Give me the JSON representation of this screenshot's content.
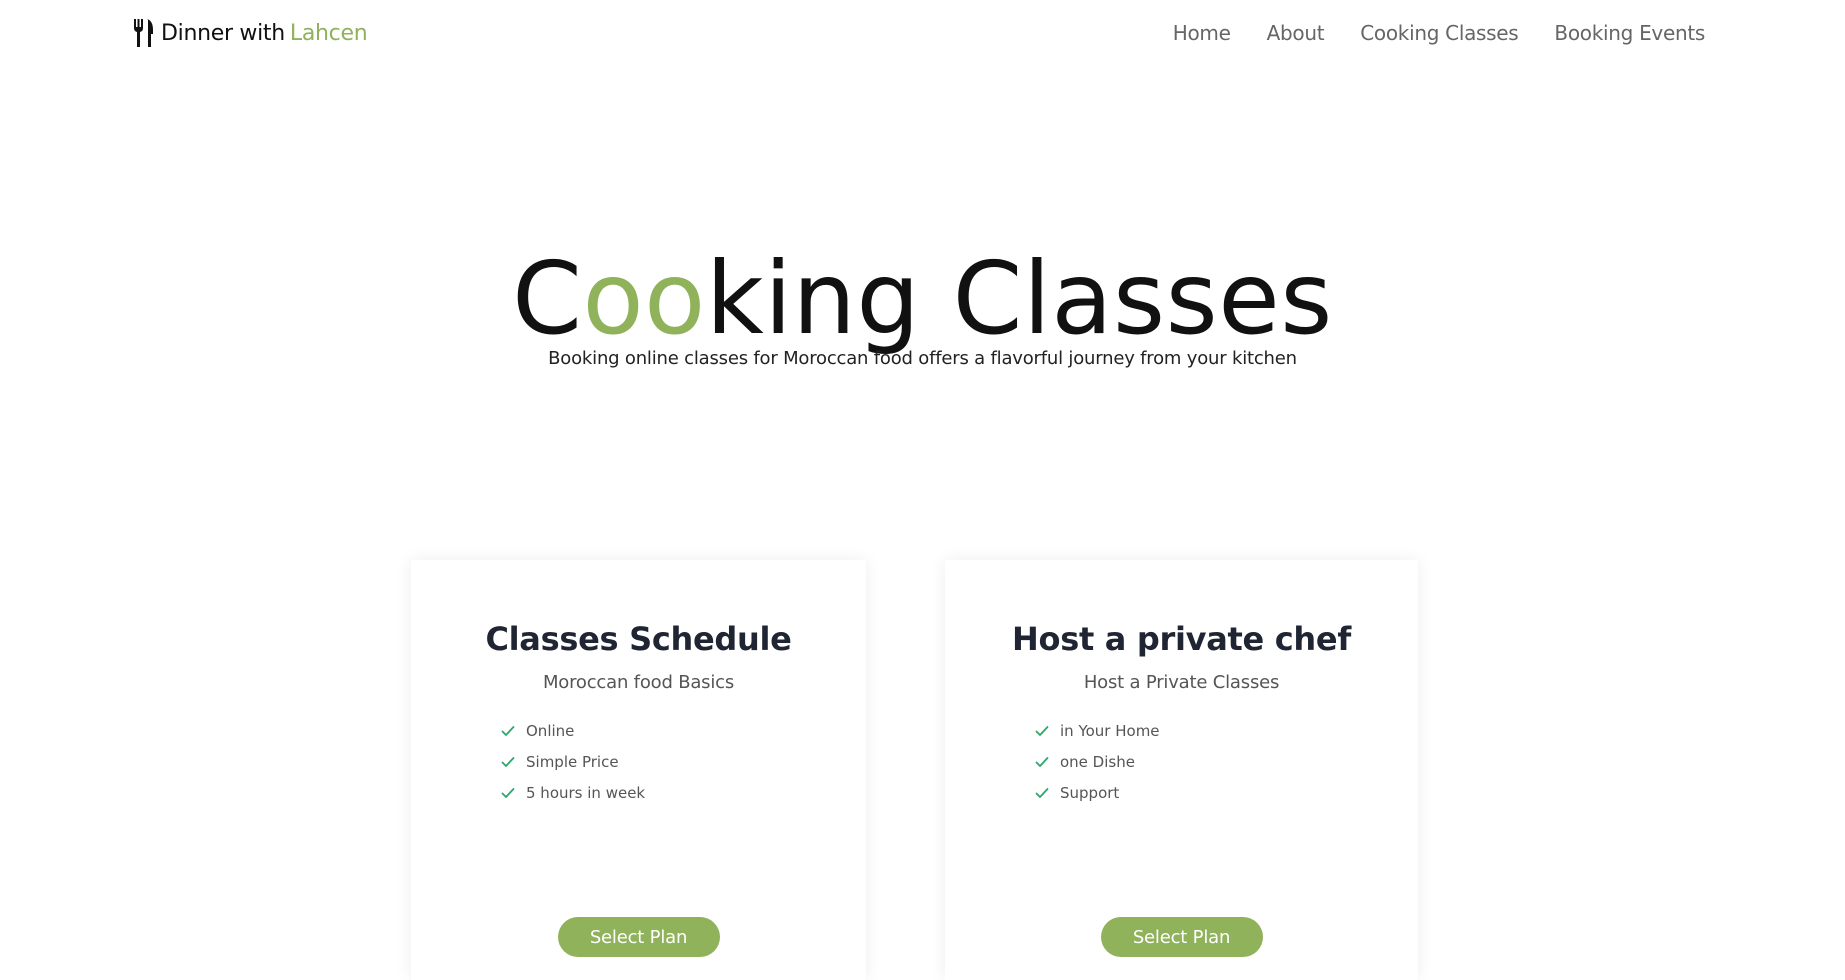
{
  "brand": {
    "name_part1": "Dinner with",
    "name_part2": "Lahcen",
    "icon": "fork-knife-icon",
    "accent_color": "#8fb25a"
  },
  "nav": {
    "items": [
      {
        "label": "Home"
      },
      {
        "label": "About"
      },
      {
        "label": "Cooking Classes"
      },
      {
        "label": "Booking Events"
      }
    ]
  },
  "hero": {
    "title_before": "C",
    "title_accent": "oo",
    "title_after": "king Classes",
    "subtitle": "Booking online classes for Moroccan food offers a flavorful journey from your kitchen"
  },
  "plans": [
    {
      "title": "Classes Schedule",
      "subtitle": "Moroccan food Basics",
      "features": [
        "Online",
        "Simple Price",
        "5 hours in week"
      ],
      "button_label": "Select Plan"
    },
    {
      "title": "Host a private chef",
      "subtitle": "Host a Private Classes",
      "features": [
        "in Your Home",
        "one Dishe",
        "Support"
      ],
      "button_label": "Select Plan"
    }
  ],
  "colors": {
    "accent": "#8fb25a",
    "check": "#2fa66a",
    "heading": "#1f2533"
  }
}
